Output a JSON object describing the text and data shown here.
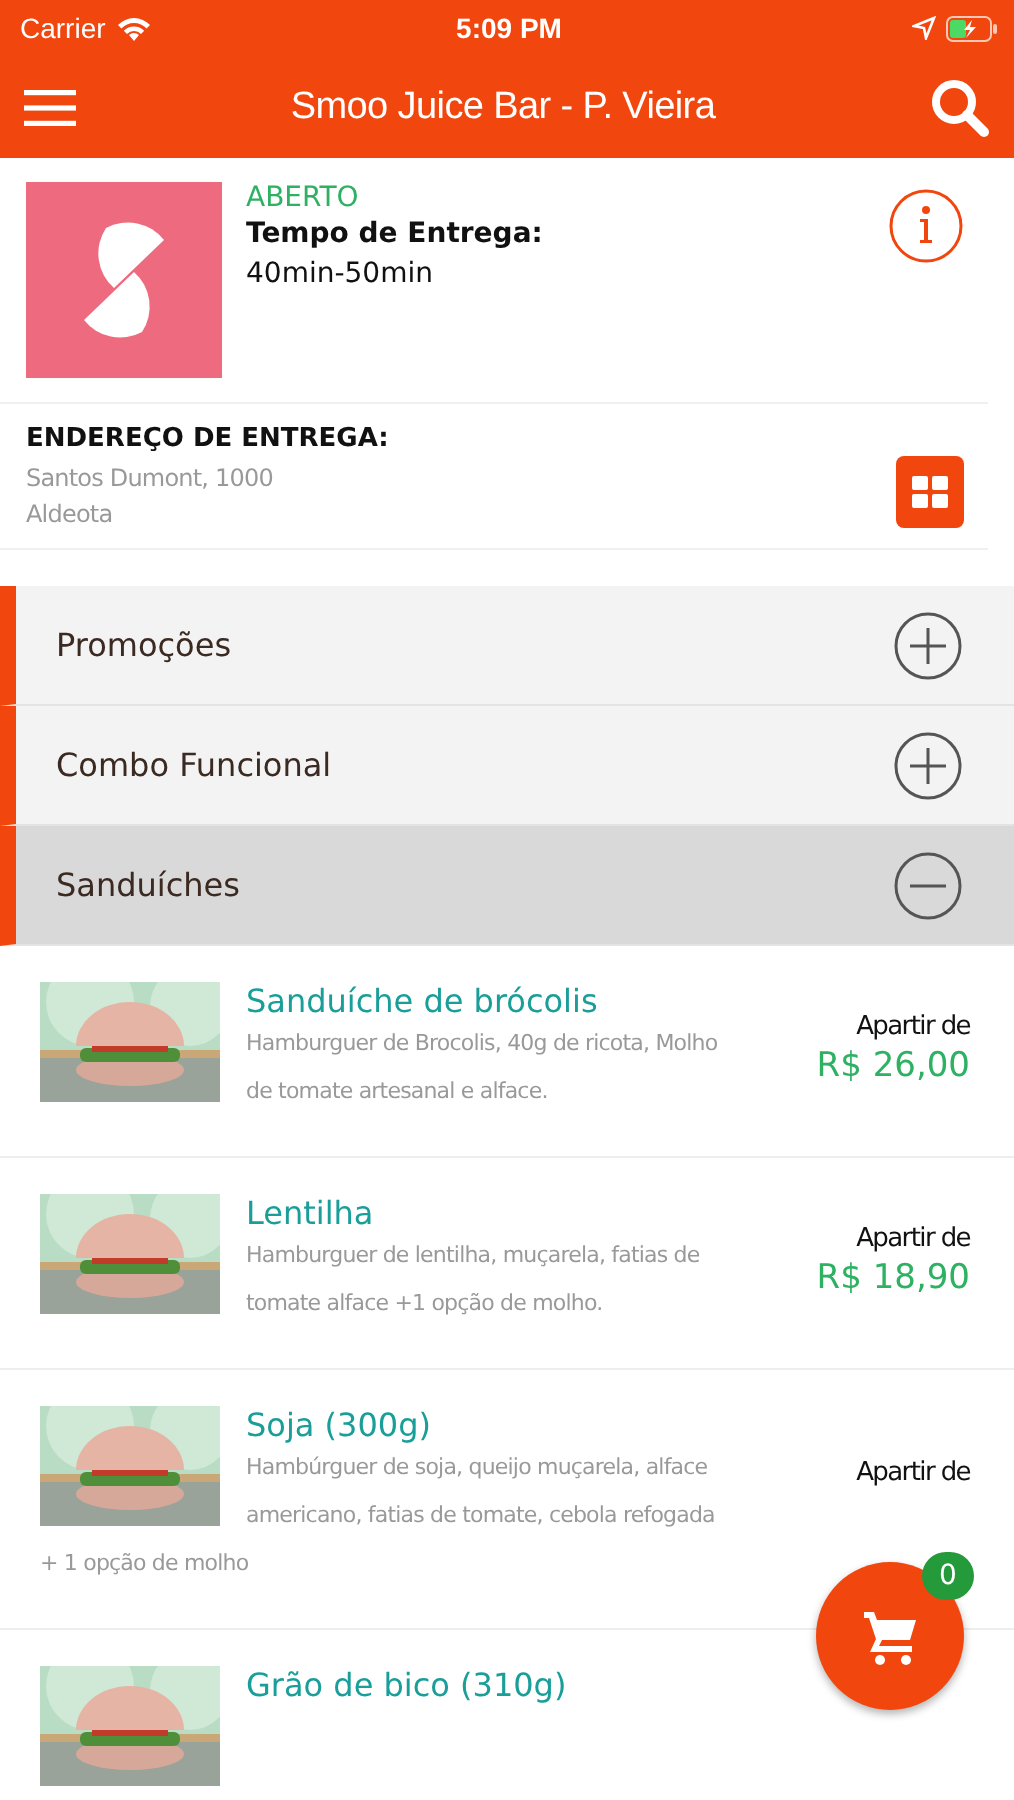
{
  "status_bar": {
    "carrier": "Carrier",
    "time": "5:09 PM"
  },
  "nav": {
    "title": "Smoo Juice Bar - P. Vieira"
  },
  "store": {
    "status": "ABERTO",
    "delivery_label": "Tempo de Entrega:",
    "delivery_time": "40min-50min"
  },
  "address": {
    "label": "ENDEREÇO DE ENTREGA:",
    "lines": [
      "Santos Dumont, 1000",
      "Aldeota"
    ]
  },
  "categories": [
    {
      "name": "Promoções",
      "expanded": false
    },
    {
      "name": "Combo Funcional",
      "expanded": false
    },
    {
      "name": "Sanduíches",
      "expanded": true
    }
  ],
  "products": [
    {
      "name": "Sanduíche de brócolis",
      "description": "Hamburguer de Brocolis, 40g de ricota, Molho de tomate artesanal e alface.",
      "price_label": "Apartir de",
      "price": "R$ 26,00"
    },
    {
      "name": "Lentilha",
      "description": "Hamburguer de lentilha, muçarela, fatias de tomate alface +1 opção de molho.",
      "price_label": "Apartir de",
      "price": "R$ 18,90"
    },
    {
      "name": "Soja (300g)",
      "description": "Hambúrguer de soja, queijo muçarela, alface americano, fatias de tomate, cebola refogada",
      "description_more": "+ 1 opção de molho",
      "price_label": "Apartir de"
    },
    {
      "name": "Grão de bico (310g)"
    }
  ],
  "cart": {
    "count": "0"
  }
}
